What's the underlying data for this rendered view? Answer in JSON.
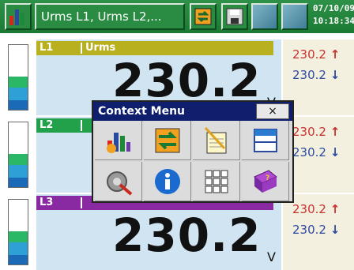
{
  "topbar": {
    "title": "Urms L1, Urms L2,...",
    "date": "07/10/09",
    "time": "10:18:34",
    "icons": [
      "bar-chart-icon",
      "cycle-icon",
      "save-icon"
    ]
  },
  "channels": [
    {
      "channel": "L1",
      "quantity": "Urms",
      "value": "230.2",
      "unit": "V",
      "max": "230.2",
      "min": "230.2",
      "tag_color": "#b9b020"
    },
    {
      "channel": "L2",
      "quantity": "",
      "value": "",
      "unit": "",
      "max": "230.2",
      "min": "230.2",
      "tag_color": "#23a14a"
    },
    {
      "channel": "L3",
      "quantity": "",
      "value": "230.2",
      "unit": "V",
      "max": "230.2",
      "min": "230.2",
      "tag_color": "#8a2aa2"
    }
  ],
  "arrows": {
    "max": "↑",
    "min": "↓"
  },
  "context_menu": {
    "title": "Context Menu",
    "close_label": "×",
    "items": [
      {
        "icon": "chart-icon"
      },
      {
        "icon": "exchange-icon"
      },
      {
        "icon": "notepad-icon"
      },
      {
        "icon": "window-split-icon"
      },
      {
        "icon": "settings-tools-icon"
      },
      {
        "icon": "info-icon"
      },
      {
        "icon": "keypad-icon"
      },
      {
        "icon": "help-book-icon"
      }
    ]
  }
}
